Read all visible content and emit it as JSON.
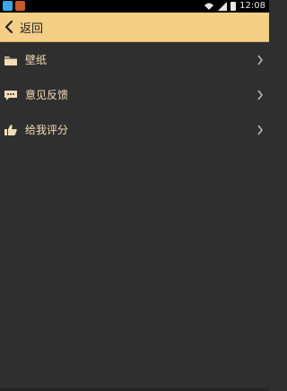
{
  "status_bar": {
    "time": "12:08"
  },
  "app_bar": {
    "back_label": "返回"
  },
  "menu": {
    "items": [
      {
        "label": "壁纸",
        "icon": "folder-icon"
      },
      {
        "label": "意见反馈",
        "icon": "chat-bubble-icon"
      },
      {
        "label": "给我评分",
        "icon": "thumbs-up-icon"
      }
    ]
  },
  "colors": {
    "accent": "#f4cf86",
    "background": "#2f2f2f",
    "text": "#f1ddb6",
    "status_bar": "#000000"
  }
}
